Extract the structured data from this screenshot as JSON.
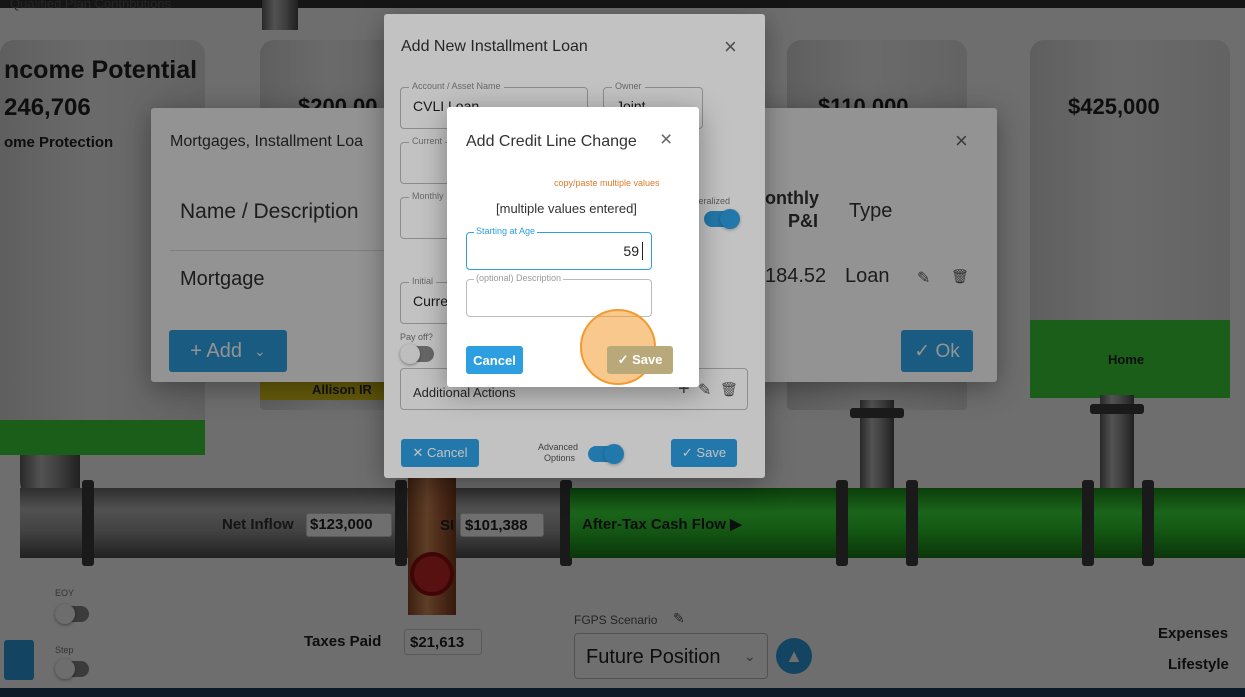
{
  "background": {
    "header_cut_text": "Qualified Plan Contributions",
    "income_title": "ncome Potential",
    "income_value": "246,706",
    "income_protection": "ome Protection",
    "tank_values": [
      "$200,00",
      "$110,000",
      "$425,000"
    ],
    "tank_label_allison": "Allison IR",
    "tank_label_home": "Home",
    "net_inflow_label": "Net Inflow",
    "net_inflow_value": "$123,000",
    "si_label": "SI",
    "si_value": "$101,388",
    "after_tax_label": "After-Tax Cash Flow ▶",
    "taxes_paid_label": "Taxes Paid",
    "taxes_paid_value": "$21,613",
    "eoy_label": "EOY",
    "step_label": "Step",
    "fgps_label": "FGPS Scenario",
    "fgps_value": "Future Position",
    "expenses_label": "Expenses",
    "lifestyle_label": "Lifestyle"
  },
  "mortgage_dialog": {
    "title": "Mortgages, Installment Loa",
    "col_name": "Name / Description",
    "col_monthly_1": "onthly",
    "col_monthly_2": "P&I",
    "col_type": "Type",
    "row_name": "Mortgage",
    "row_monthly": "184.52",
    "row_type": "Loan",
    "add_label": "+ Add",
    "ok_label": "✓ Ok"
  },
  "installment_dialog": {
    "title": "Add New Installment Loan",
    "account_label": "Account / Asset Name",
    "account_value": "CVLI Loan",
    "owner_label": "Owner",
    "owner_value": "Joint",
    "current_label": "Current",
    "monthly_label": "Monthly",
    "collateralized_label": "lateralized",
    "initial_label": "Initial",
    "initial_value": "Curre",
    "payoff_label": "Pay off?",
    "additional_actions": "Additional Actions",
    "advanced_label_1": "Advanced",
    "advanced_label_2": "Options",
    "cancel_label": "✕ Cancel",
    "save_label": "✓ Save"
  },
  "credit_dialog": {
    "title": "Add Credit Line Change",
    "copy_paste_link": "copy/paste multiple values",
    "multiple_values": "[multiple values entered]",
    "starting_age_label": "Starting at Age",
    "starting_age_value": "59",
    "description_label": "(optional) Description",
    "cancel_label": "Cancel",
    "save_label": "✓ Save"
  },
  "colors": {
    "accent": "#2d9ee0",
    "highlight": "#f39a2e",
    "green": "#3fd83f",
    "orange_text": "#e07a2c"
  }
}
